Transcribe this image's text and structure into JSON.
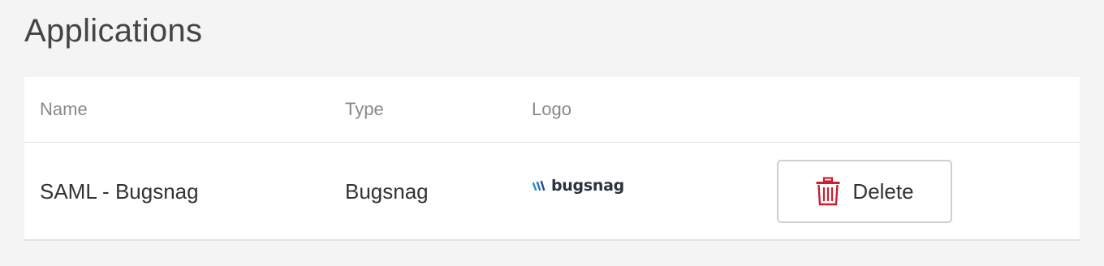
{
  "page": {
    "title": "Applications"
  },
  "table": {
    "columns": {
      "name": "Name",
      "type": "Type",
      "logo": "Logo"
    },
    "rows": [
      {
        "name": "SAML - Bugsnag",
        "type": "Bugsnag",
        "logo_text": "bugsnag",
        "logo_icon": "bugsnag-logo-icon",
        "delete_label": "Delete",
        "delete_icon": "trash-icon"
      }
    ]
  },
  "colors": {
    "background": "#f4f4f4",
    "card": "#ffffff",
    "delete_icon": "#cc1f2f",
    "logo_accent": "#1f8dd6"
  }
}
